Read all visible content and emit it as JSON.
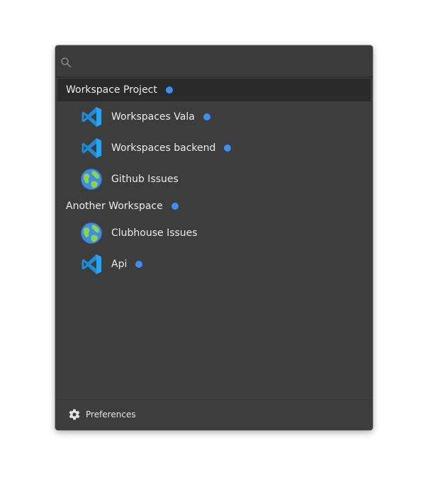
{
  "search": {
    "value": "",
    "placeholder": ""
  },
  "icons": {
    "search": "search-icon",
    "vscode": "vscode-icon",
    "globe": "globe-icon",
    "gear": "gear-icon"
  },
  "colors": {
    "background": "#3d3d3d",
    "selected_row": "#2b2b2b",
    "status_dot": "#3f8ef2",
    "text": "#ececec"
  },
  "workspaces": [
    {
      "name": "Workspace Project",
      "selected": true,
      "has_dot": true,
      "items": [
        {
          "label": "Workspaces Vala",
          "icon": "vscode-icon",
          "has_dot": true
        },
        {
          "label": "Workspaces backend",
          "icon": "vscode-icon",
          "has_dot": true
        },
        {
          "label": "Github Issues",
          "icon": "globe-icon",
          "has_dot": false
        }
      ]
    },
    {
      "name": "Another Workspace",
      "selected": false,
      "has_dot": true,
      "items": [
        {
          "label": "Clubhouse Issues",
          "icon": "globe-icon",
          "has_dot": false
        },
        {
          "label": "Api",
          "icon": "vscode-icon",
          "has_dot": true
        }
      ]
    }
  ],
  "footer": {
    "preferences_label": "Preferences"
  }
}
